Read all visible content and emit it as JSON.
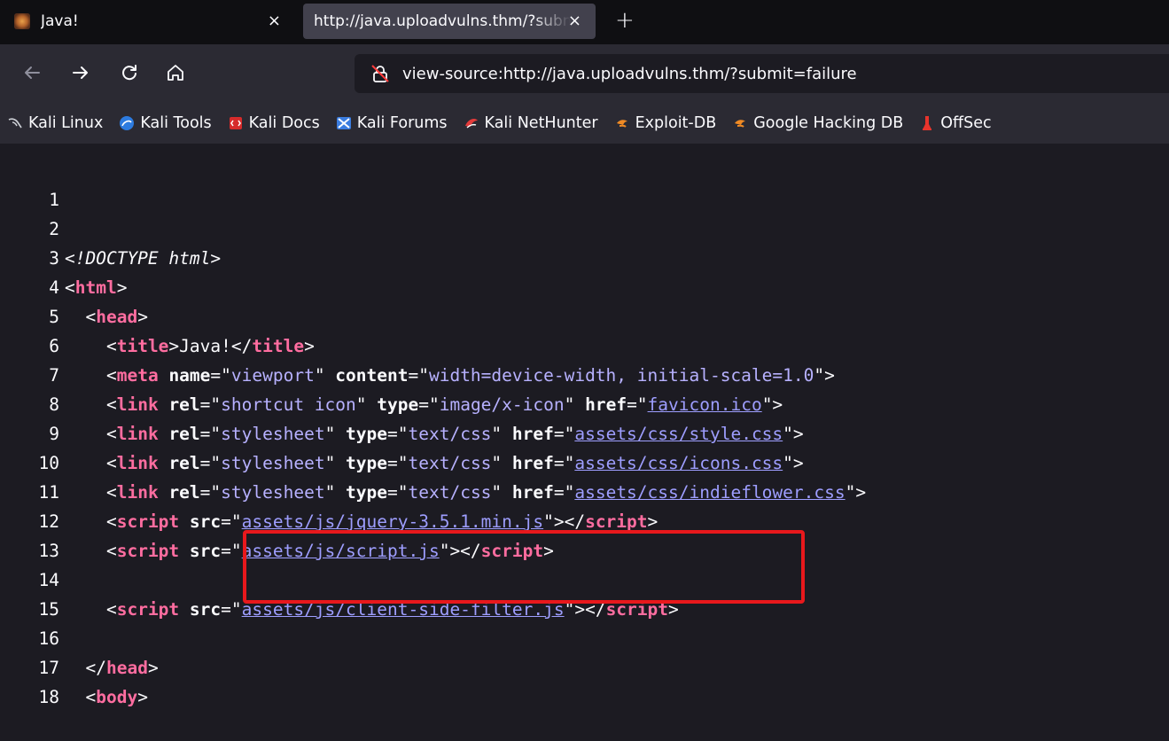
{
  "tabs": [
    {
      "title": "Java!",
      "close": "×",
      "active": false
    },
    {
      "title": "http://java.uploadvulns.thm/?submit=failure",
      "close": "×",
      "active": true
    }
  ],
  "new_tab": "+",
  "nav": {
    "back_icon": "arrow-left-icon",
    "forward_icon": "arrow-right-icon",
    "reload_icon": "reload-icon",
    "home_icon": "home-icon",
    "url": "view-source:http://java.uploadvulns.thm/?submit=failure",
    "security_icon": "insecure-connection-icon"
  },
  "bookmarks": [
    {
      "label": "Kali Linux",
      "icon": "kali-dragon-icon"
    },
    {
      "label": "Kali Tools",
      "icon": "kali-tools-icon"
    },
    {
      "label": "Kali Docs",
      "icon": "kali-docs-icon"
    },
    {
      "label": "Kali Forums",
      "icon": "kali-forums-icon"
    },
    {
      "label": "Kali NetHunter",
      "icon": "kali-nethunter-icon"
    },
    {
      "label": "Exploit-DB",
      "icon": "exploit-db-icon"
    },
    {
      "label": "Google Hacking DB",
      "icon": "ghdb-icon"
    },
    {
      "label": "OffSec",
      "icon": "offsec-icon"
    }
  ],
  "source": {
    "line_numbers": [
      "1",
      "2",
      "3",
      "4",
      "5",
      "6",
      "7",
      "8",
      "9",
      "10",
      "11",
      "12",
      "13",
      "14",
      "15",
      "16",
      "17",
      "18"
    ],
    "doctype": "<!DOCTYPE html>",
    "t_html": "html",
    "t_head": "head",
    "t_title": "title",
    "title_text": "Java!",
    "t_meta": "meta",
    "t_link": "link",
    "t_script": "script",
    "t_body": "body",
    "a_name": "name",
    "a_content": "content",
    "a_rel": "rel",
    "a_type": "type",
    "a_href": "href",
    "a_src": "src",
    "v_viewport": "viewport",
    "v_content": "width=device-width, initial-scale=1.0",
    "v_shortcut": "shortcut icon",
    "v_xicon": "image/x-icon",
    "v_stylesheet": "stylesheet",
    "v_textcss": "text/css",
    "h_favicon": "favicon.ico",
    "h_style": "assets/css/style.css",
    "h_icons": "assets/css/icons.css",
    "h_indie": "assets/css/indieflower.css",
    "s_jquery": "assets/js/jquery-3.5.1.min.js",
    "s_script": "assets/js/script.js",
    "s_filter": "assets/js/client-side-filter.js"
  },
  "colors": {
    "tag": "#ff6da0",
    "value": "#b7b1ff",
    "link": "#9e9eff",
    "highlight": "#e8181c"
  }
}
